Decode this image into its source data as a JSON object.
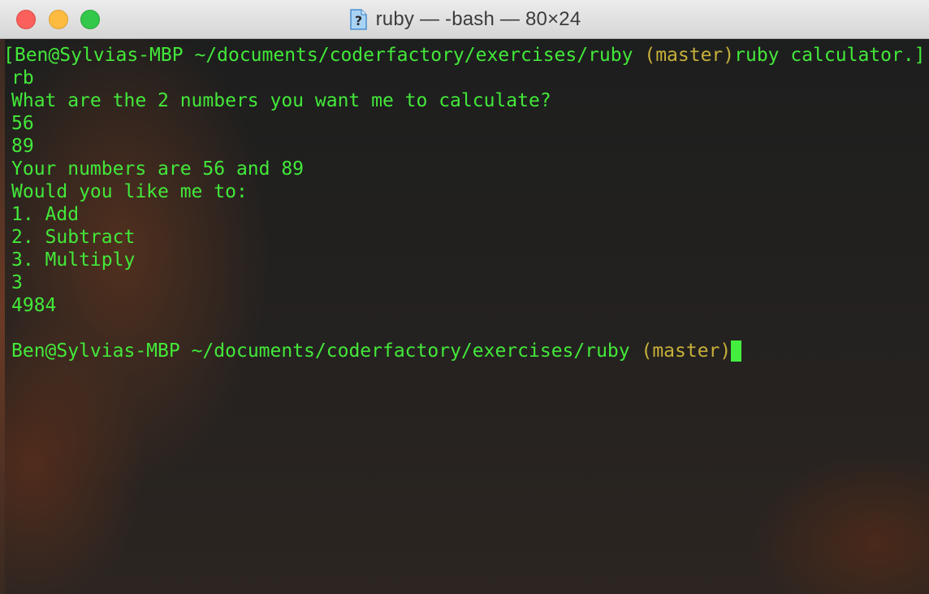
{
  "window": {
    "title": "ruby — -bash — 80×24",
    "title_icon": "question-document-icon"
  },
  "terminal": {
    "prompt_user": "Ben@Sylvias-MBP",
    "prompt_path": "~/documents/coderfactory/exercises/ruby",
    "prompt_branch": "(master)",
    "first_line_prefix": "[",
    "command": "ruby calculator.]",
    "command_wrap": "rb",
    "output": [
      "What are the 2 numbers you want me to calculate?",
      "56",
      "89",
      "Your numbers are 56 and 89",
      "Would you like me to:",
      "1. Add",
      "2. Subtract",
      "3. Multiply",
      "3",
      "4984",
      ""
    ]
  },
  "colors": {
    "text_green": "#43e83a",
    "branch_yellow": "#c6b03a",
    "cursor_green": "#43ee3f"
  }
}
